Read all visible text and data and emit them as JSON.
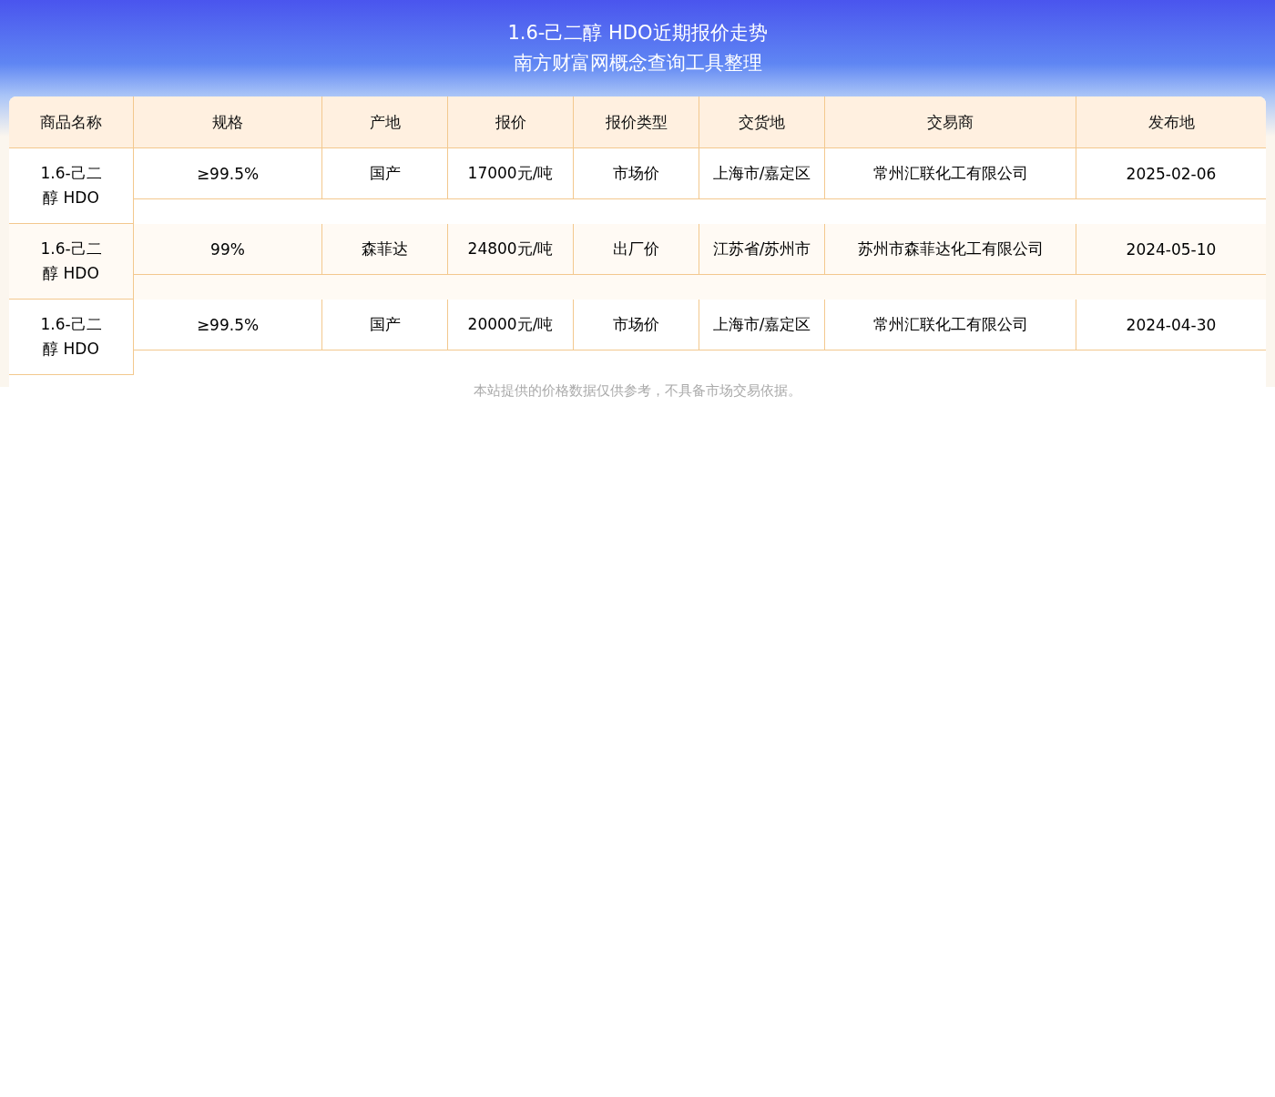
{
  "title": [
    "1.6-己二醇 HDO近期报价走势",
    "南方财富网概念查询工具整理"
  ],
  "table": {
    "columns": [
      "商品名称",
      "规格",
      "产地",
      "报价",
      "报价类型",
      "交货地",
      "交易商",
      "发布地"
    ],
    "rows": [
      {
        "cells": [
          "1.6-己二醇 HDO",
          "≥99.5%",
          "国产",
          "17000元/吨",
          "市场价",
          "上海市/嘉定区",
          "常州汇联化工有限公司",
          "2025-02-06"
        ]
      },
      {
        "cells": [
          "1.6-己二醇 HDO",
          "99%",
          "森菲达",
          "24800元/吨",
          "出厂价",
          "江苏省/苏州市",
          "苏州市森菲达化工有限公司",
          "2024-05-10"
        ]
      },
      {
        "cells": [
          "1.6-己二醇 HDO",
          "≥99.5%",
          "国产",
          "20000元/吨",
          "市场价",
          "上海市/嘉定区",
          "常州汇联化工有限公司",
          "2024-04-30"
        ]
      }
    ]
  },
  "footnote": "本站提供的价格数据仅供参考，不具备市场交易依据。"
}
